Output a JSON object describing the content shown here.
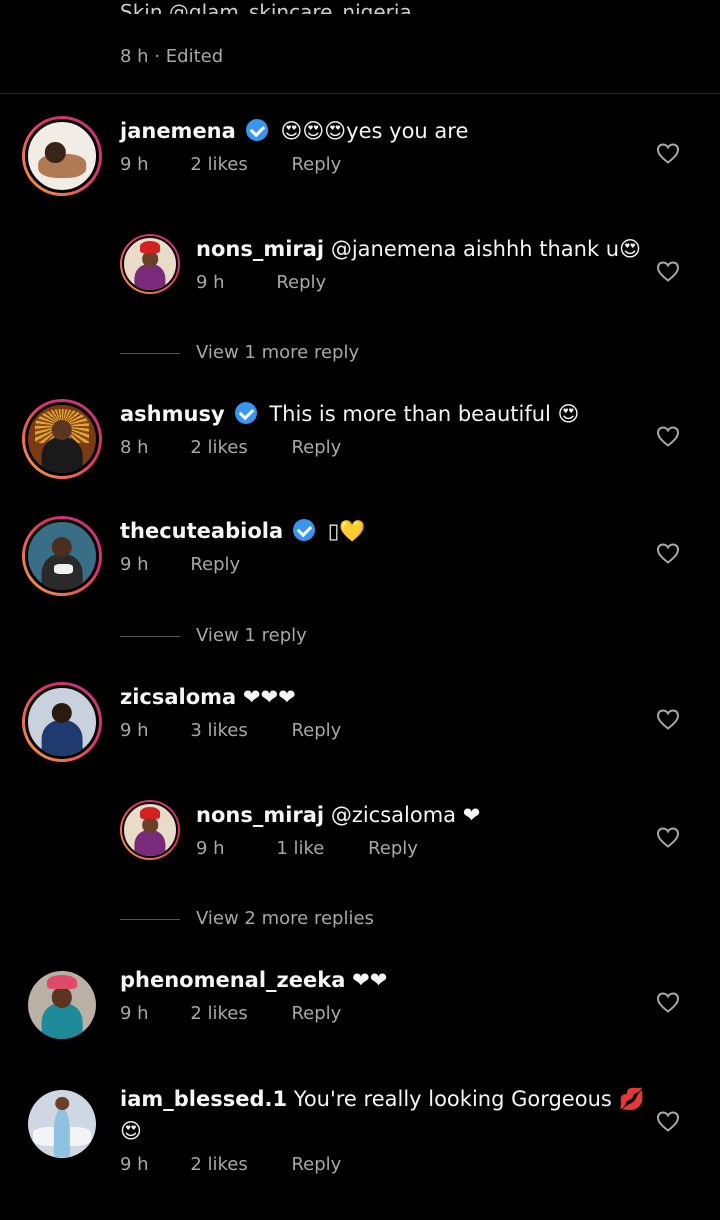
{
  "top": {
    "cut_text": "Skin @glam_skincare_nigeria",
    "time": "8 h",
    "sep": "·",
    "edited": "Edited"
  },
  "comments": [
    {
      "user": "janemena",
      "text": "😍😍😍yes you are",
      "time": "9 h",
      "likes": "2 likes",
      "reply": "Reply",
      "verified": true
    },
    {
      "user": "nons_miraj",
      "text": "@janemena aishhh thank u😍",
      "time": "9 h",
      "likes": "",
      "reply": "Reply"
    },
    {
      "user": "ashmusy",
      "text": "This is more than beautiful 😍",
      "time": "8 h",
      "likes": "2 likes",
      "reply": "Reply",
      "verified": true
    },
    {
      "user": "thecuteabiola",
      "text": "▯💛",
      "time": "9 h",
      "likes": "",
      "reply": "Reply",
      "verified": true
    },
    {
      "user": "zicsaloma",
      "text": "❤❤❤",
      "time": "9 h",
      "likes": "3 likes",
      "reply": "Reply"
    },
    {
      "user": "nons_miraj",
      "text": "@zicsaloma ❤",
      "time": "9 h",
      "likes": "1 like",
      "reply": "Reply"
    },
    {
      "user": "phenomenal_zeeka",
      "text": "❤❤",
      "time": "9 h",
      "likes": "2 likes",
      "reply": "Reply"
    },
    {
      "user": "iam_blessed.1",
      "text": "You're really looking Gorgeous 💋",
      "text2": "😍",
      "time": "9 h",
      "likes": "2 likes",
      "reply": "Reply"
    }
  ],
  "view_replies": [
    "View 1 more reply",
    "View 1 reply",
    "View 2 more replies"
  ],
  "icons": {
    "like": "heart-outline-icon",
    "verified": "verified-badge-icon"
  },
  "colors": {
    "background": "#000000",
    "verified": "#3797f0",
    "muted": "#a8a8a8"
  }
}
